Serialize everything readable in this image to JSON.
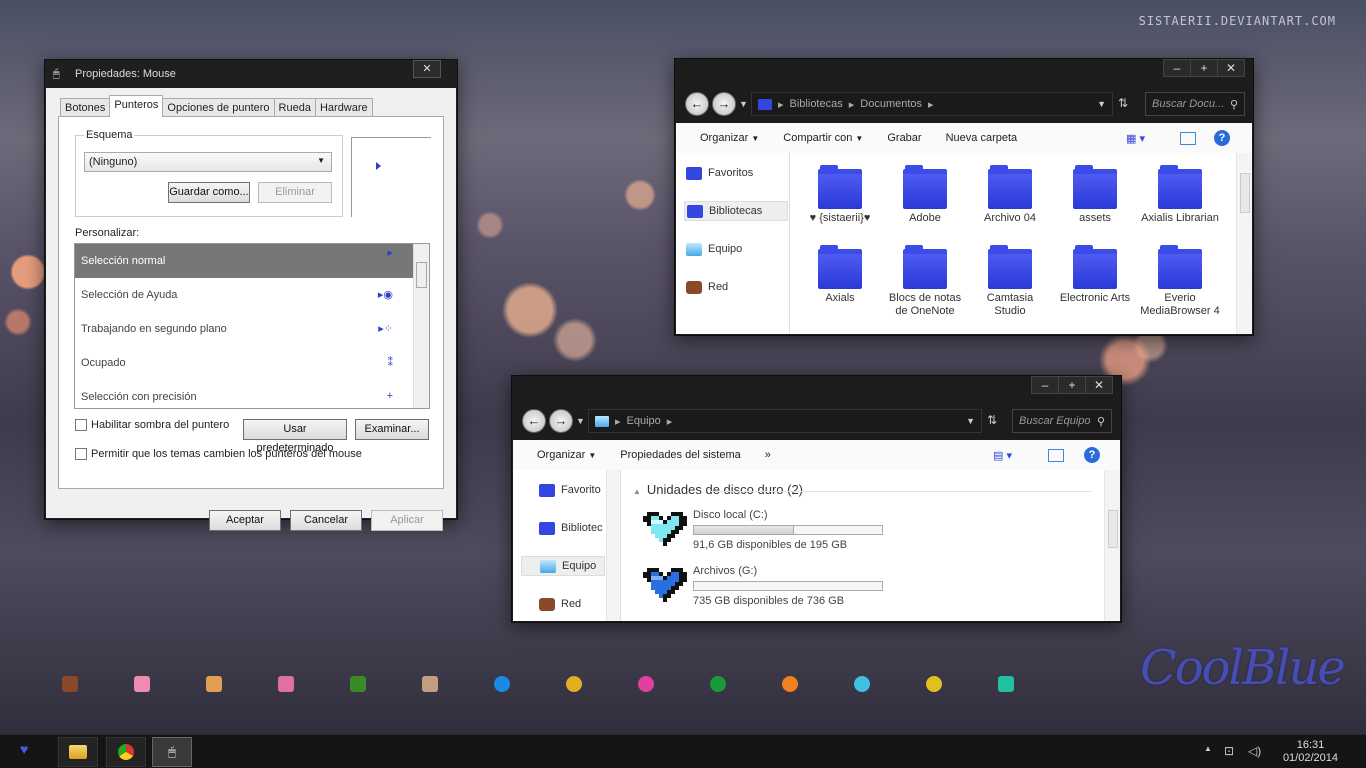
{
  "desktop": {
    "watermark": "SISTAERII.DEVIANTART.COM",
    "brand": "CoolBlue"
  },
  "mouse_dialog": {
    "title": "Propiedades: Mouse",
    "close": "✕",
    "tabs": [
      "Botones",
      "Punteros",
      "Opciones de puntero",
      "Rueda",
      "Hardware"
    ],
    "active_tab": "Punteros",
    "scheme_label": "Esquema",
    "scheme_value": "(Ninguno)",
    "save_as": "Guardar como...",
    "delete": "Eliminar",
    "customize_label": "Personalizar:",
    "pointers": [
      "Selección normal",
      "Selección de Ayuda",
      "Trabajando en segundo plano",
      "Ocupado",
      "Selección con precisión"
    ],
    "shadow_label": "Habilitar sombra del puntero",
    "use_default": "Usar predeterminado",
    "browse": "Examinar...",
    "themes_label": "Permitir que los temas cambien los punteros del mouse",
    "ok": "Aceptar",
    "cancel": "Cancelar",
    "apply": "Aplicar"
  },
  "docs_window": {
    "buttons": [
      "–",
      "+",
      "✕"
    ],
    "breadcrumb": [
      "Bibliotecas",
      "Documentos"
    ],
    "search_placeholder": "Buscar Docu...",
    "toolbar": {
      "organize": "Organizar",
      "share": "Compartir con",
      "burn": "Grabar",
      "new_folder": "Nueva carpeta"
    },
    "sidebar": [
      "Favoritos",
      "Bibliotecas",
      "Equipo",
      "Red"
    ],
    "folders": [
      "♥ {sistaerii}♥",
      "Adobe",
      "Archivo 04",
      "assets",
      "Axialis Librarian",
      "Axials",
      "Blocs de notas de OneNote",
      "Camtasia Studio",
      "Electronic Arts",
      "Everio MediaBrowser 4"
    ]
  },
  "computer_window": {
    "buttons": [
      "–",
      "+",
      "✕"
    ],
    "breadcrumb": [
      "Equipo"
    ],
    "search_placeholder": "Buscar Equipo",
    "toolbar": {
      "organize": "Organizar",
      "properties": "Propiedades del sistema",
      "more": "»"
    },
    "sidebar": [
      "Favorito",
      "Bibliotec",
      "Equipo",
      "Red"
    ],
    "section": "Unidades de disco duro (2)",
    "drives": [
      {
        "name": "Disco local (C:)",
        "free": "91,6 GB disponibles de 195 GB",
        "used_fraction": 0.53
      },
      {
        "name": "Archivos (G:)",
        "free": "735 GB disponibles de 736 GB",
        "used_fraction": 0.0
      }
    ]
  },
  "taskbar": {
    "time": "16:31",
    "date": "01/02/2014"
  }
}
